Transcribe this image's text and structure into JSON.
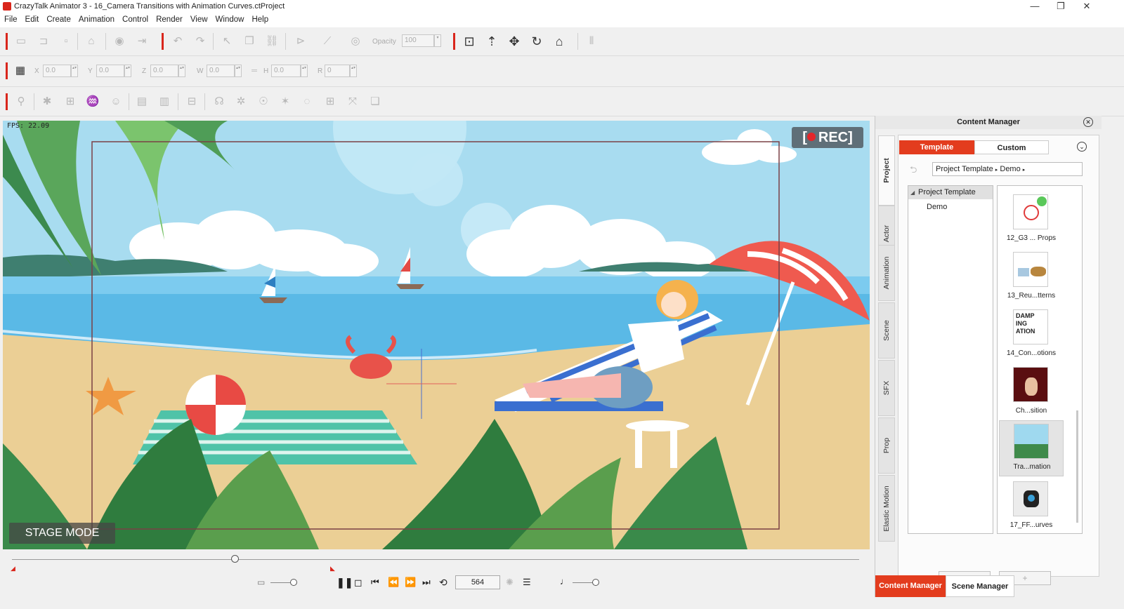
{
  "window": {
    "title": "CrazyTalk Animator 3  - 16_Camera Transitions with Animation Curves.ctProject",
    "minimize": "—",
    "restore": "❐",
    "close": "✕"
  },
  "menu": [
    "File",
    "Edit",
    "Create",
    "Animation",
    "Control",
    "Render",
    "View",
    "Window",
    "Help"
  ],
  "toolbar1": {
    "opacity_label": "Opacity",
    "opacity_value": "100"
  },
  "toolbar2": {
    "fields": [
      {
        "label": "X",
        "value": "0.0"
      },
      {
        "label": "Y",
        "value": "0.0"
      },
      {
        "label": "Z",
        "value": "0.0"
      },
      {
        "label": "W",
        "value": "0.0"
      },
      {
        "label": "H",
        "value": "0.0"
      },
      {
        "label": "R",
        "value": "0"
      }
    ]
  },
  "stage": {
    "fps": "FPS: 22.09",
    "rec": "REC",
    "mode": "STAGE MODE"
  },
  "playback": {
    "frame": "564"
  },
  "content_manager": {
    "title": "Content Manager",
    "vertical_tabs": [
      "Project",
      "Actor",
      "Animation",
      "Scene",
      "SFX",
      "Prop",
      "Elastic Motion"
    ],
    "active_vertical_tab": "Project",
    "tabs": [
      "Template",
      "Custom"
    ],
    "active_tab": "Template",
    "breadcrumb": [
      "Project Template",
      "Demo"
    ],
    "tree": {
      "root": "Project Template",
      "children": [
        "Demo"
      ]
    },
    "items": [
      {
        "caption": "12_G3 ... Props"
      },
      {
        "caption": "13_Reu...tterns"
      },
      {
        "caption": "14_Con...otions",
        "thumb_text": "DAMP ING  ATION"
      },
      {
        "caption": "Ch...sition"
      },
      {
        "caption": "Tra...mation"
      },
      {
        "caption": "17_FF...urves"
      }
    ],
    "bottom_tabs": [
      "Content Manager",
      "Scene Manager"
    ],
    "active_bottom_tab": "Content Manager"
  },
  "colors": {
    "accent": "#d9261c",
    "sky": "#9fd9ef",
    "sea": "#5ab9e6",
    "sand": "#ebcf95"
  }
}
